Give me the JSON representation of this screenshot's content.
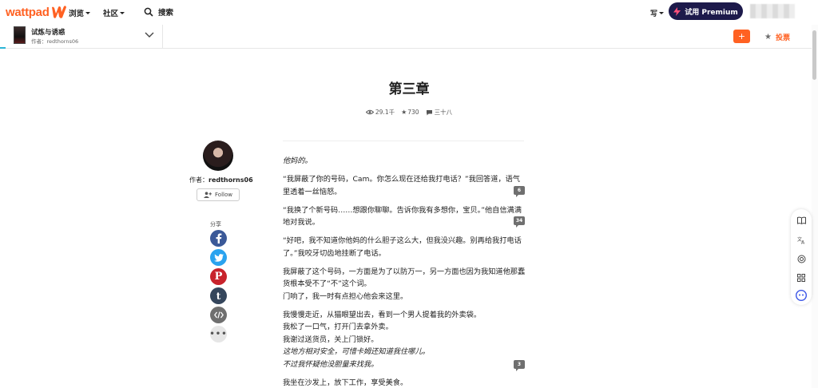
{
  "header": {
    "logo_text": "wattpad",
    "nav": [
      {
        "label": "浏览"
      },
      {
        "label": "社区"
      }
    ],
    "search_label": "搜索",
    "write_label": "写",
    "premium_label": "试用 Premium",
    "brand_color": "#ff6122"
  },
  "story": {
    "title": "试炼与诱惑",
    "author_line": "作者：redthorns06",
    "vote_label": "投票",
    "add_label": "+"
  },
  "chapter": {
    "title": "第三章",
    "reads": "29.1千",
    "votes": "730",
    "comments": "三十八"
  },
  "author": {
    "prefix": "作者：",
    "name": "redthorns06",
    "follow_label": "Follow",
    "share_label": "分享"
  },
  "share_buttons": [
    "facebook-icon",
    "twitter-icon",
    "pinterest-icon",
    "tumblr-icon",
    "embed-icon",
    "more-icon"
  ],
  "paragraphs": [
    {
      "text": "他妈的。",
      "italic": true
    },
    {
      "text": "“我屏蔽了你的号码，Cam。你怎么现在还给我打电话？”我回答道，语气里透着一丝恼怒。",
      "italic": false
    },
    {
      "text": "“我换了个新号码……想跟你聊聊。告诉你我有多想你，宝贝。”他自信满满地对我说。",
      "italic": false
    },
    {
      "text": "“好吧，我不知道你他妈的什么胆子这么大，但我没兴趣。别再给我打电话了。”我咬牙切齿地挂断了电话。",
      "italic": false
    },
    {
      "text": "我屏蔽了这个号码，一方面是为了以防万一，另一方面也因为我知道他那蠢货根本受不了“不”这个词。",
      "italic": false,
      "tight": true
    },
    {
      "text": "门响了，我一时有点担心他会来这里。",
      "italic": false
    },
    {
      "text": "我慢慢走近，从猫眼望出去，看到一个男人提着我的外卖袋。",
      "italic": false,
      "tight": true
    },
    {
      "text": "我松了一口气，打开门去拿外卖。",
      "italic": false,
      "tight": true
    },
    {
      "text": "我谢过送货员，关上门锁好。",
      "italic": false,
      "tight": true
    },
    {
      "text": "这地方相对安全，可惜卡姆还知道我住哪儿。",
      "italic": true,
      "tight": true
    },
    {
      "text": "不过我怀疑他没胆量来找我。",
      "italic": true
    },
    {
      "text": "我坐在沙发上，放下工作，享受美食。",
      "italic": false
    }
  ],
  "comment_badges": [
    "6",
    "34",
    "3"
  ]
}
